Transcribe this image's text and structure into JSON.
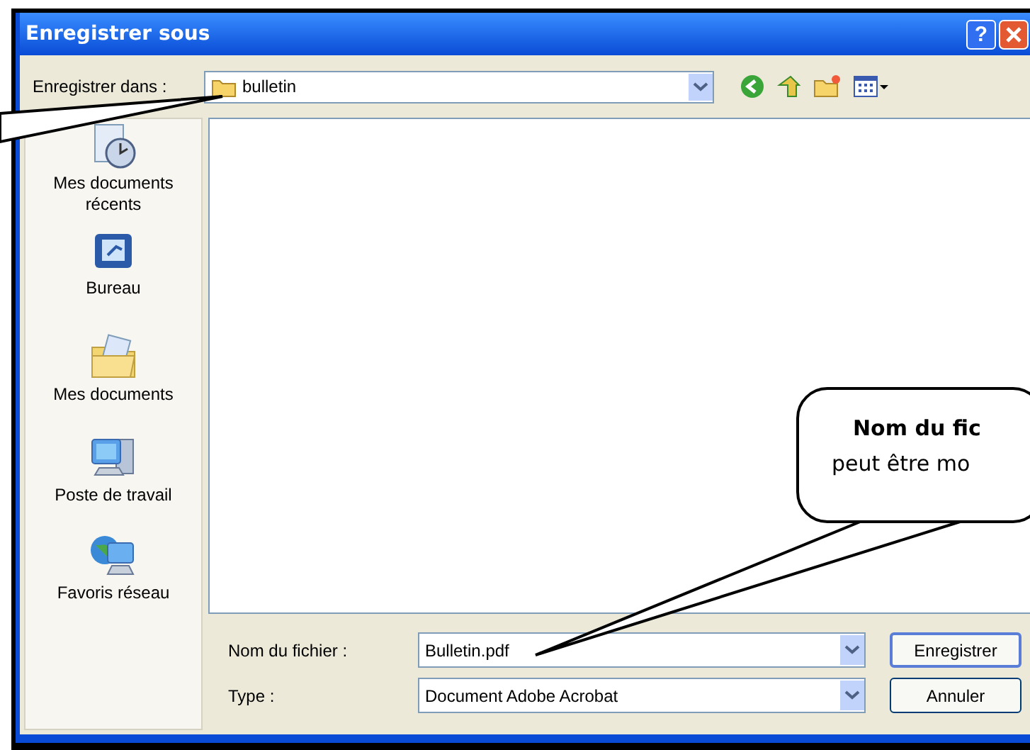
{
  "window": {
    "title": "Enregistrer sous",
    "help": "?"
  },
  "location": {
    "label": "Enregistrer dans :",
    "value": "bulletin"
  },
  "places": [
    {
      "label": "Mes documents récents",
      "kind": "recent"
    },
    {
      "label": "Bureau",
      "kind": "desktop"
    },
    {
      "label": "Mes documents",
      "kind": "documents"
    },
    {
      "label": "Poste de travail",
      "kind": "computer"
    },
    {
      "label": "Favoris réseau",
      "kind": "network"
    }
  ],
  "filename": {
    "label": "Nom du fichier :",
    "value": "Bulletin.pdf"
  },
  "filetype": {
    "label": "Type :",
    "value": "Document Adobe Acrobat"
  },
  "buttons": [
    {
      "label": "Enregistrer",
      "default": true
    },
    {
      "label": "Annuler",
      "default": false
    }
  ],
  "callout": {
    "lines": [
      "Nom du fic",
      "peut être mo"
    ]
  }
}
